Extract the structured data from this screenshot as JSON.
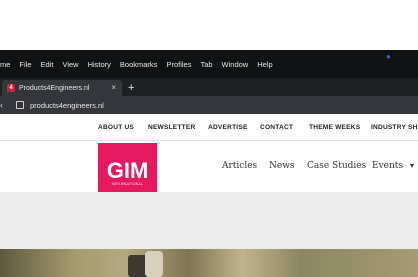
{
  "menubar": {
    "items": [
      "me",
      "File",
      "Edit",
      "View",
      "History",
      "Bookmarks",
      "Profiles",
      "Tab",
      "Window",
      "Help"
    ]
  },
  "tab": {
    "favicon_glyph": "4",
    "title": "Products4Engineers.nl",
    "close_glyph": "×",
    "new_tab_glyph": "+"
  },
  "address": {
    "url": "products4engineers.nl"
  },
  "utility_nav": {
    "items": [
      "ABOUT US",
      "NEWSLETTER",
      "ADVERTISE",
      "CONTACT",
      "THEME WEEKS",
      "INDUSTRY SH"
    ]
  },
  "logo": {
    "text": "GIM",
    "tagline": "INTERNATIONAL"
  },
  "main_nav": {
    "items": [
      "Articles",
      "News",
      "Case Studies",
      "Events"
    ]
  },
  "colors": {
    "brand": "#e5195f",
    "menubar_bg": "#101213",
    "tab_bg": "#34363b"
  }
}
